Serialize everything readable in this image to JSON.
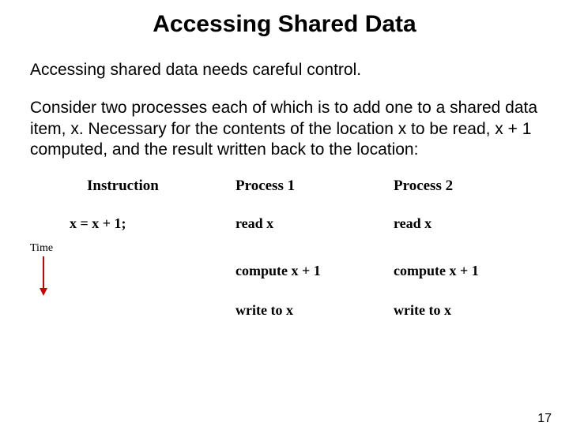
{
  "title": "Accessing Shared Data",
  "para1": "Accessing shared data needs careful control.",
  "para2": "Consider two processes each of which is to add one to a shared data item, x. Necessary for the contents of the location x to be read, x + 1 computed, and the result written back to the location:",
  "headers": {
    "instruction": "Instruction",
    "process1": "Process 1",
    "process2": "Process 2"
  },
  "instruction_row": "x = x + 1;",
  "steps": {
    "read": "read x",
    "compute": "compute x + 1",
    "write": "write to x"
  },
  "time_label": "Time",
  "page_number": "17"
}
